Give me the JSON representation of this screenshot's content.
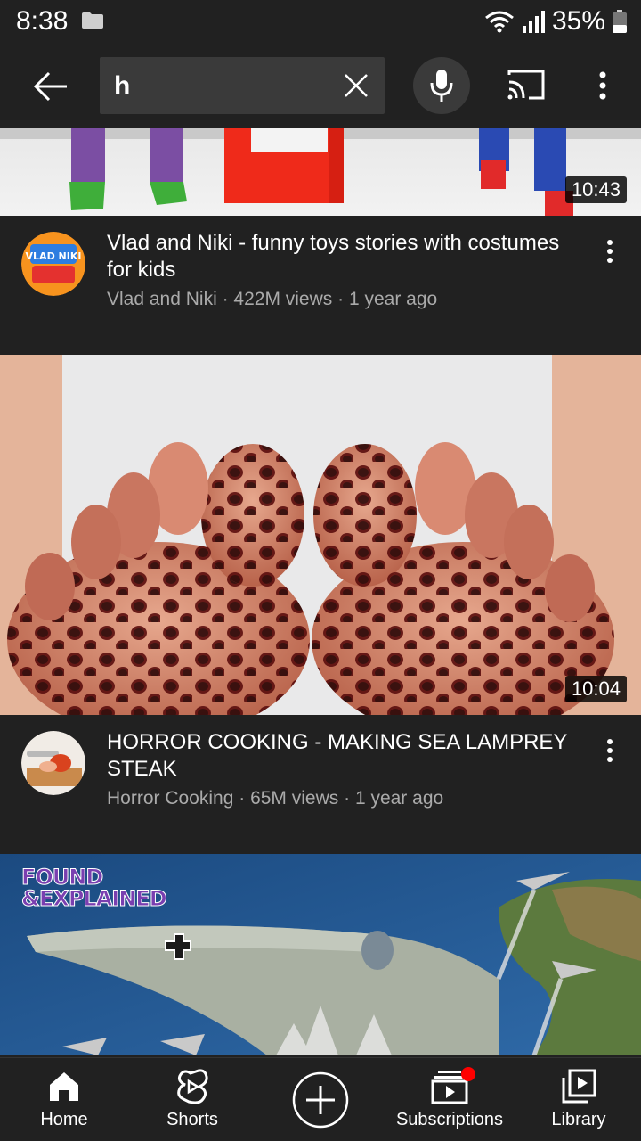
{
  "status_bar": {
    "time": "8:38",
    "battery": "35%"
  },
  "search": {
    "query": "h"
  },
  "videos": [
    {
      "duration": "10:43",
      "title": "Vlad and Niki - funny toys stories with costumes for kids",
      "channel": "Vlad and Niki",
      "views": "422M views",
      "age": "1 year ago",
      "avatar_text": "VLAD NIKI"
    },
    {
      "duration": "10:04",
      "title": "HORROR COOKING - MAKING SEA LAMPREY STEAK",
      "channel": "Horror Cooking",
      "views": "65M views",
      "age": "1 year ago"
    },
    {
      "overlay_logo_line1": "FOUND",
      "overlay_logo_line2": "&EXPLAINED"
    }
  ],
  "nav": {
    "home": "Home",
    "shorts": "Shorts",
    "subscriptions": "Subscriptions",
    "library": "Library"
  },
  "colors": {
    "background": "#212121",
    "secondary_text": "#aaaaaa",
    "notification_dot": "#ff0000"
  }
}
